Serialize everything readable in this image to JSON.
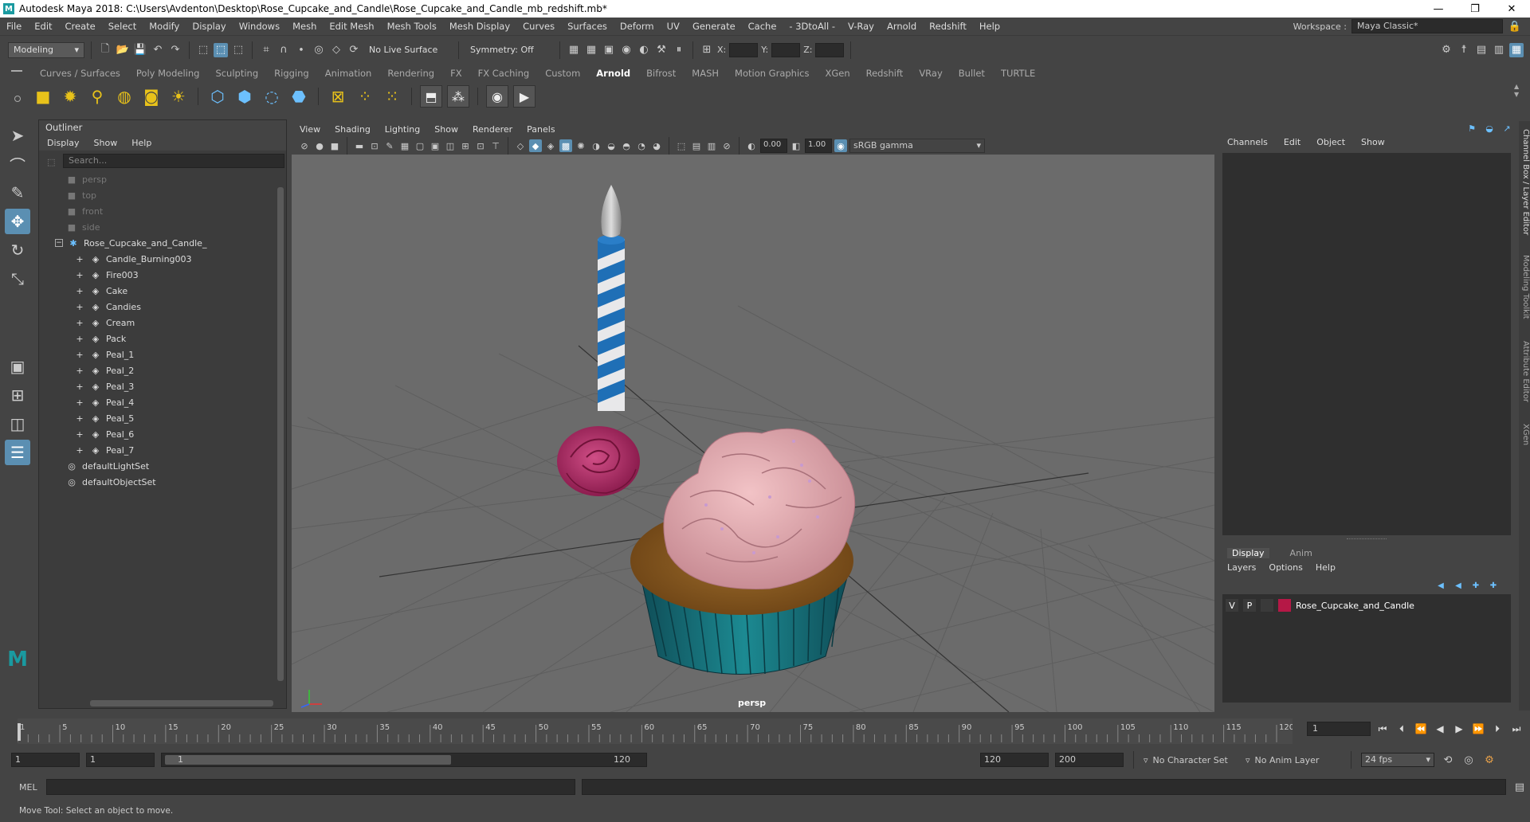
{
  "window": {
    "title": "Autodesk Maya 2018: C:\\Users\\Avdenton\\Desktop\\Rose_Cupcake_and_Candle\\Rose_Cupcake_and_Candle_mb_redshift.mb*"
  },
  "menubar": {
    "items": [
      "File",
      "Edit",
      "Create",
      "Select",
      "Modify",
      "Display",
      "Windows",
      "Mesh",
      "Edit Mesh",
      "Mesh Tools",
      "Mesh Display",
      "Curves",
      "Surfaces",
      "Deform",
      "UV",
      "Generate",
      "Cache",
      "- 3DtoAll -",
      "V-Ray",
      "Arnold",
      "Redshift",
      "Help"
    ],
    "workspace_label": "Workspace :",
    "workspace_value": "Maya Classic*"
  },
  "statusline": {
    "mode": "Modeling",
    "live_surface": "No Live Surface",
    "symmetry": "Symmetry: Off",
    "x_label": "X:",
    "y_label": "Y:",
    "z_label": "Z:"
  },
  "shelf": {
    "tabs": [
      "Curves / Surfaces",
      "Poly Modeling",
      "Sculpting",
      "Rigging",
      "Animation",
      "Rendering",
      "FX",
      "FX Caching",
      "Custom",
      "Arnold",
      "Bifrost",
      "MASH",
      "Motion Graphics",
      "XGen",
      "Redshift",
      "VRay",
      "Bullet",
      "TURTLE"
    ],
    "active_tab": "Arnold"
  },
  "outliner": {
    "title": "Outliner",
    "menu": [
      "Display",
      "Show",
      "Help"
    ],
    "search_placeholder": "Search...",
    "cameras": [
      "persp",
      "top",
      "front",
      "side"
    ],
    "group": "Rose_Cupcake_and_Candle_",
    "children": [
      "Candle_Burning003",
      "Fire003",
      "Cake",
      "Candies",
      "Cream",
      "Pack",
      "Peal_1",
      "Peal_2",
      "Peal_3",
      "Peal_4",
      "Peal_5",
      "Peal_6",
      "Peal_7"
    ],
    "sets": [
      "defaultLightSet",
      "defaultObjectSet"
    ]
  },
  "viewport": {
    "menu": [
      "View",
      "Shading",
      "Lighting",
      "Show",
      "Renderer",
      "Panels"
    ],
    "exposure": "0.00",
    "gamma": "1.00",
    "colorspace": "sRGB gamma",
    "camera_label": "persp"
  },
  "channelbox": {
    "menu": [
      "Channels",
      "Edit",
      "Object",
      "Show"
    ]
  },
  "layers": {
    "tabs": [
      "Display",
      "Anim"
    ],
    "active_tab": "Display",
    "menu": [
      "Layers",
      "Options",
      "Help"
    ],
    "layer_v": "V",
    "layer_p": "P",
    "layer_name": "Rose_Cupcake_and_Candle",
    "layer_color": "#b51846"
  },
  "sidetabs": [
    "Channel Box / Layer Editor",
    "Modeling Toolkit",
    "Attribute Editor",
    "XGen"
  ],
  "timeline": {
    "ticks": [
      "1",
      "5",
      "10",
      "15",
      "20",
      "25",
      "30",
      "35",
      "40",
      "45",
      "50",
      "55",
      "60",
      "65",
      "70",
      "75",
      "80",
      "85",
      "90",
      "95",
      "100",
      "105",
      "110",
      "115",
      "120"
    ],
    "current_frame": "1"
  },
  "range": {
    "start": "1",
    "playback_start": "1",
    "slider_start": "1",
    "slider_end": "120",
    "playback_end": "120",
    "end": "200",
    "character_set": "No Character Set",
    "anim_layer": "No Anim Layer",
    "fps": "24 fps"
  },
  "cmdline": {
    "lang": "MEL"
  },
  "helpline": {
    "text": "Move Tool: Select an object to move."
  }
}
